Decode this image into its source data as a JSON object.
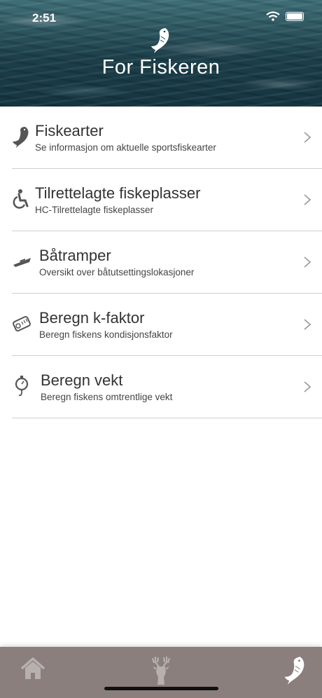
{
  "status_bar": {
    "time": "2:51"
  },
  "header": {
    "title": "For Fiskeren"
  },
  "menu": [
    {
      "title": "Fiskearter",
      "subtitle": "Se informasjon om aktuelle sportsfiskearter",
      "icon": "fish-icon"
    },
    {
      "title": "Tilrettelagte fiskeplasser",
      "subtitle": "HC-Tilrettelagte fiskeplasser",
      "icon": "wheelchair-icon"
    },
    {
      "title": "Båtramper",
      "subtitle": "Oversikt over båtutsettingslokasjoner",
      "icon": "boat-icon"
    },
    {
      "title": "Beregn k-faktor",
      "subtitle": "Beregn fiskens kondisjonsfaktor",
      "icon": "measuring-tape-icon"
    },
    {
      "title": "Beregn vekt",
      "subtitle": "Beregn fiskens omtrentlige vekt",
      "icon": "scale-icon"
    }
  ],
  "tabbar": {
    "tabs": [
      {
        "name": "home",
        "icon": "home-icon"
      },
      {
        "name": "hunting",
        "icon": "deer-icon"
      },
      {
        "name": "fishing",
        "icon": "fish-icon",
        "active": true
      }
    ],
    "background": "#8a7f7d"
  }
}
